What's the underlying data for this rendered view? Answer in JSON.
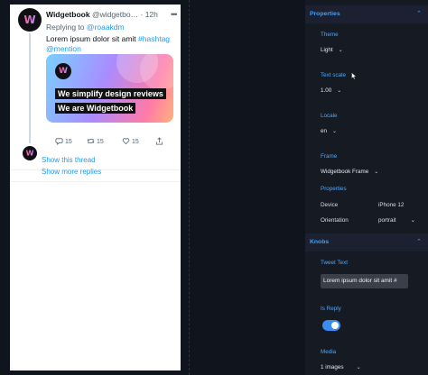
{
  "tweet": {
    "name": "Widgetbook",
    "handle": "@widgetbo…",
    "separator": "·",
    "time": "12h",
    "replying_prefix": "Replying to",
    "replying_handle": "@roaakdm",
    "text_plain": "Lorem ipsum dolor sit amit",
    "hashtag": "#hashtag",
    "mention": "@mention",
    "media_line1": "We simplify design reviews",
    "media_line2": "We are Widgetbook",
    "counts": {
      "reply": "15",
      "retweet": "15",
      "like": "15"
    }
  },
  "thread": {
    "show_thread": "Show this thread",
    "show_more": "Show more replies"
  },
  "panel": {
    "properties_title": "Properties",
    "theme_label": "Theme",
    "theme_value": "Light",
    "text_scale_label": "Text scale",
    "text_scale_value": "1.00",
    "locale_label": "Locale",
    "locale_value": "en",
    "frame_label": "Frame",
    "frame_value": "Widgetbook Frame",
    "frame_props_label": "Properties",
    "device_label": "Device",
    "device_value": "iPhone 12",
    "orientation_label": "Orientation",
    "orientation_value": "portrait",
    "knobs_title": "Knobs",
    "tweet_text_label": "Tweet Text",
    "tweet_text_value": "Lorem ipsum dolor sit amit #",
    "is_reply_label": "Is Reply",
    "is_reply_value": true,
    "media_label": "Media",
    "media_value": "1 images"
  },
  "colors": {
    "accent": "#3ea0ff",
    "link": "#1d9bf0",
    "panel_bg": "#151a23",
    "page_bg": "#10141c"
  }
}
